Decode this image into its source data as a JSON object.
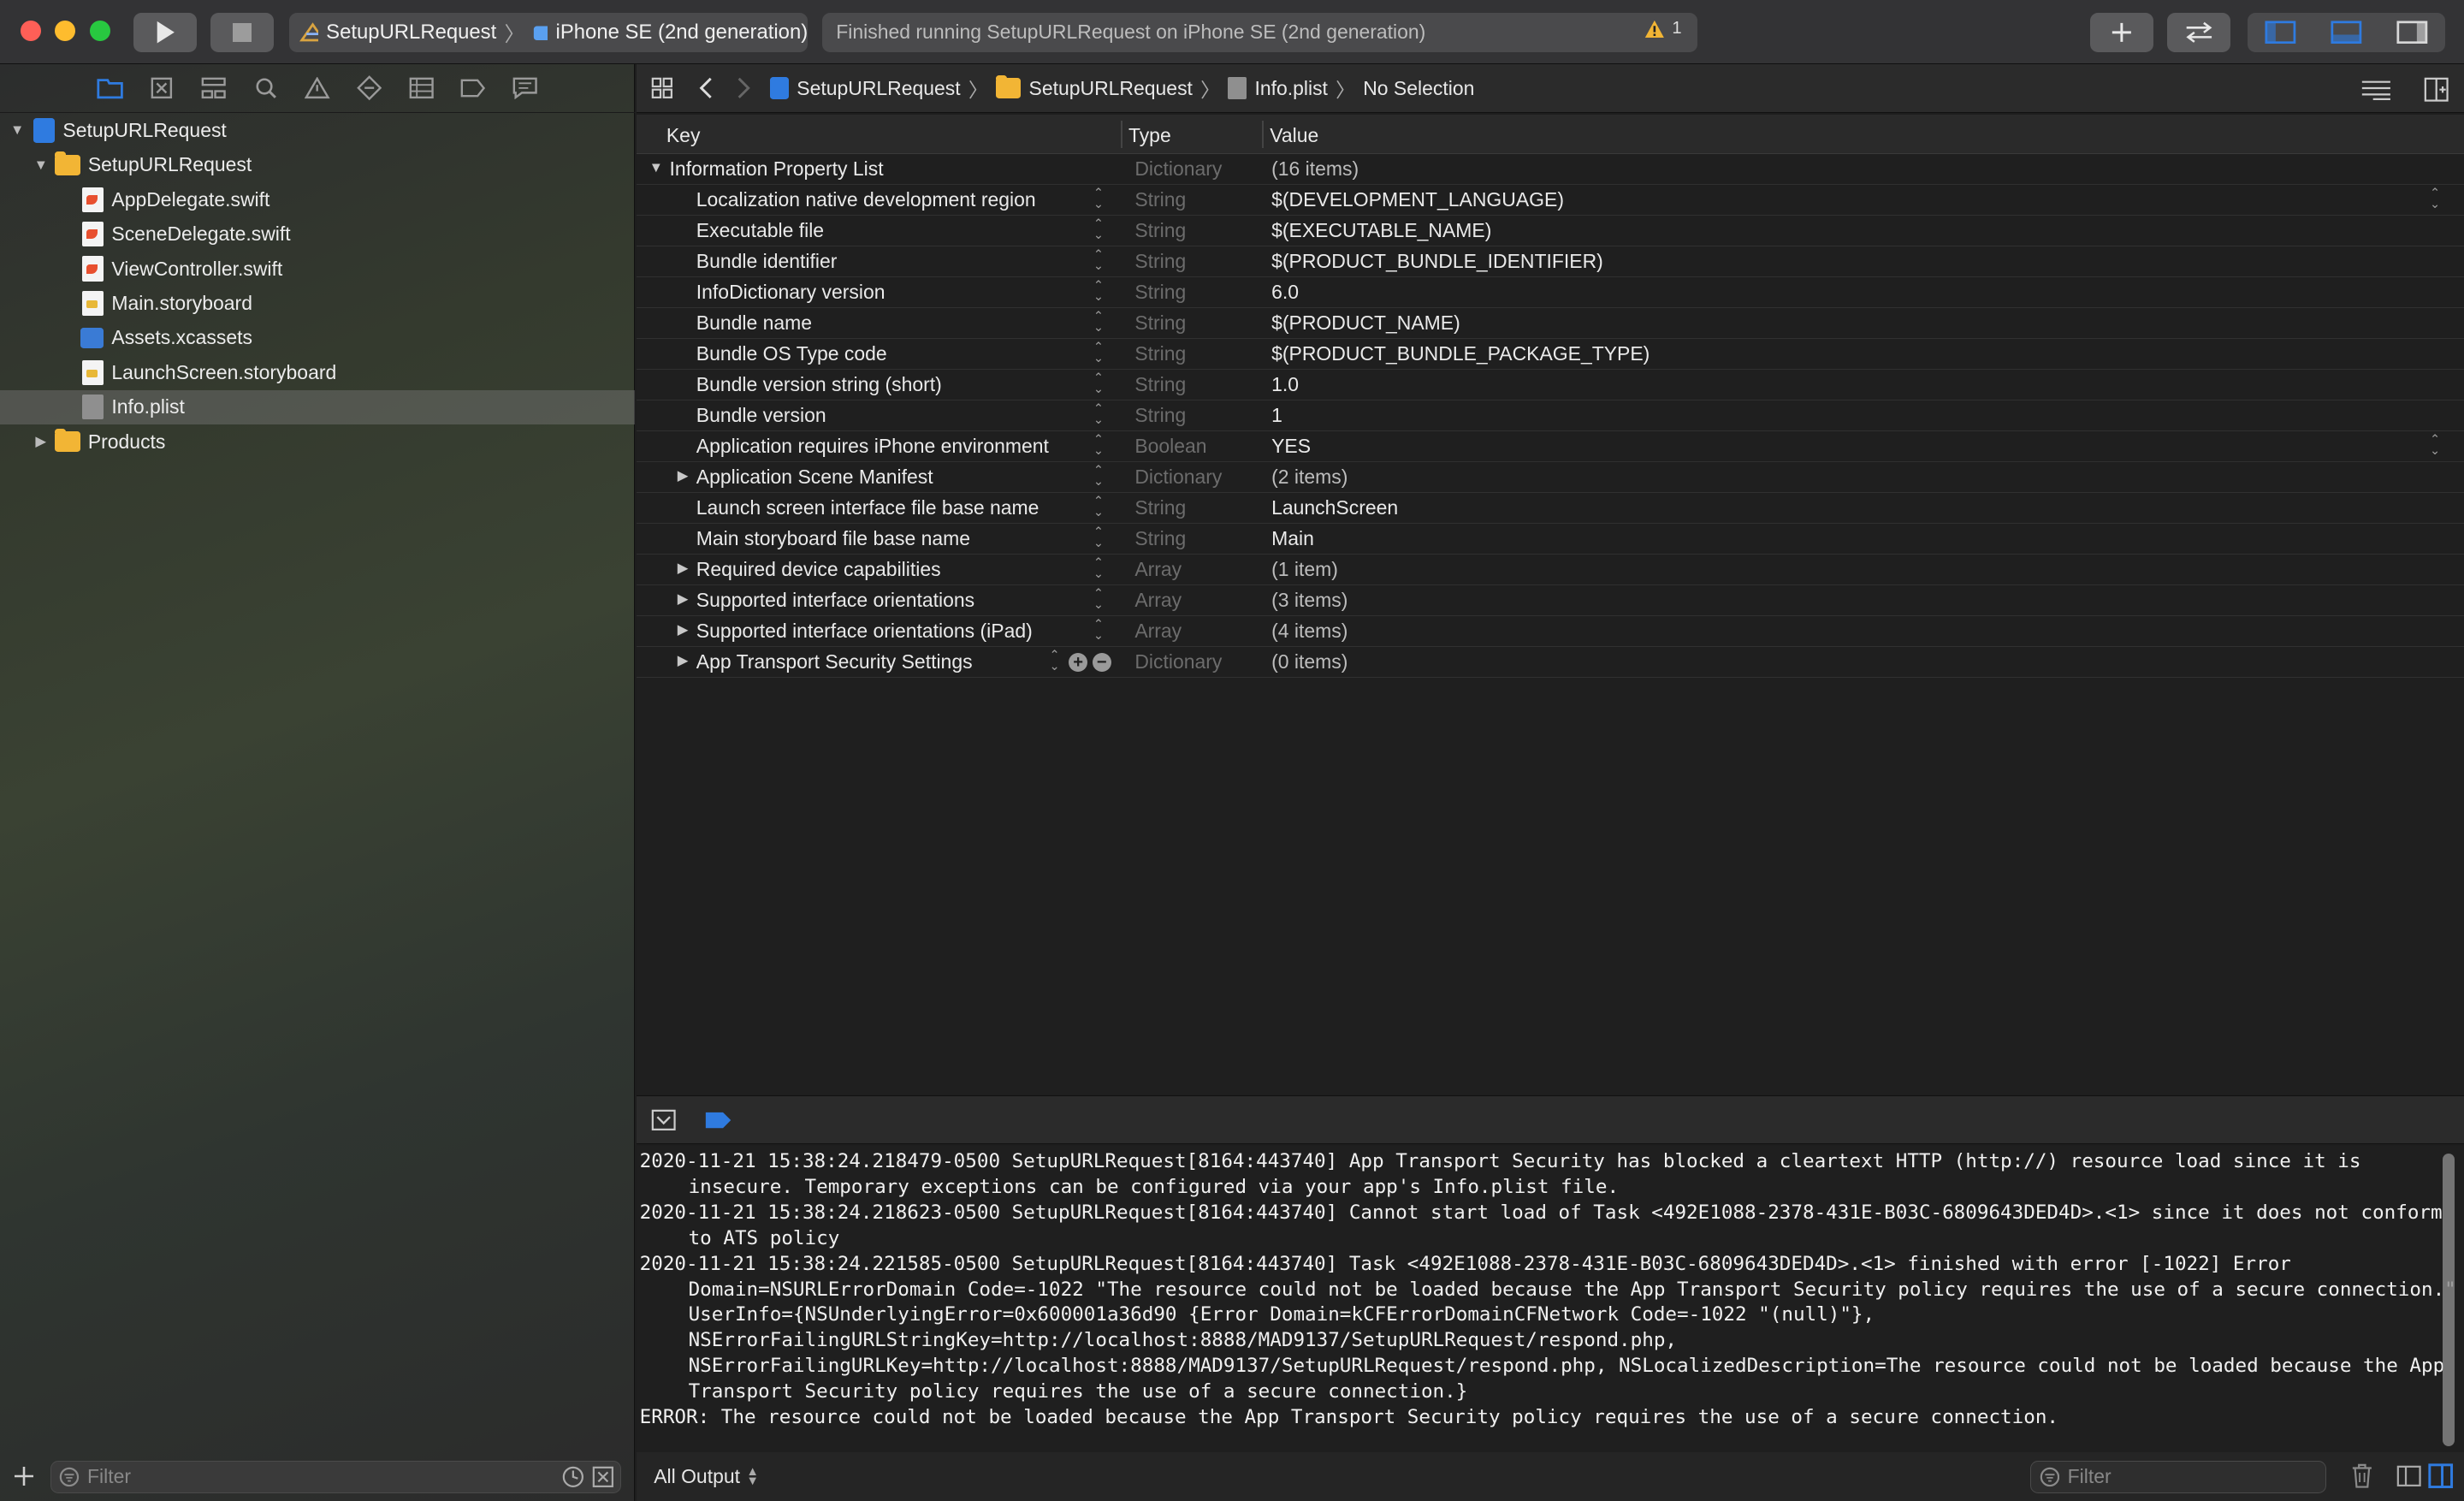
{
  "toolbar": {
    "scheme_name": "SetupURLRequest",
    "destination": "iPhone SE (2nd generation)",
    "status_text": "Finished running SetupURLRequest on iPhone SE (2nd generation)",
    "warning_count": "1"
  },
  "navigator": {
    "tree": [
      {
        "label": "SetupURLRequest",
        "kind": "project",
        "level": 0,
        "expanded": true
      },
      {
        "label": "SetupURLRequest",
        "kind": "folder",
        "level": 1,
        "expanded": true
      },
      {
        "label": "AppDelegate.swift",
        "kind": "swift",
        "level": 2
      },
      {
        "label": "SceneDelegate.swift",
        "kind": "swift",
        "level": 2
      },
      {
        "label": "ViewController.swift",
        "kind": "swift",
        "level": 2
      },
      {
        "label": "Main.storyboard",
        "kind": "storyboard",
        "level": 2
      },
      {
        "label": "Assets.xcassets",
        "kind": "assets",
        "level": 2
      },
      {
        "label": "LaunchScreen.storyboard",
        "kind": "storyboard",
        "level": 2
      },
      {
        "label": "Info.plist",
        "kind": "plist",
        "level": 2,
        "selected": true
      },
      {
        "label": "Products",
        "kind": "folder",
        "level": 1,
        "expanded": false
      }
    ],
    "filter_placeholder": "Filter"
  },
  "jumpbar": {
    "project": "SetupURLRequest",
    "group": "SetupURLRequest",
    "file": "Info.plist",
    "selection": "No Selection"
  },
  "plist": {
    "headers": {
      "key": "Key",
      "type": "Type",
      "value": "Value"
    },
    "root": {
      "key": "Information Property List",
      "type": "Dictionary",
      "value": "(16 items)"
    },
    "rows": [
      {
        "key": "Localization native development region",
        "type": "String",
        "value": "$(DEVELOPMENT_LANGUAGE)",
        "value_stepper": true
      },
      {
        "key": "Executable file",
        "type": "String",
        "value": "$(EXECUTABLE_NAME)"
      },
      {
        "key": "Bundle identifier",
        "type": "String",
        "value": "$(PRODUCT_BUNDLE_IDENTIFIER)"
      },
      {
        "key": "InfoDictionary version",
        "type": "String",
        "value": "6.0"
      },
      {
        "key": "Bundle name",
        "type": "String",
        "value": "$(PRODUCT_NAME)"
      },
      {
        "key": "Bundle OS Type code",
        "type": "String",
        "value": "$(PRODUCT_BUNDLE_PACKAGE_TYPE)"
      },
      {
        "key": "Bundle version string (short)",
        "type": "String",
        "value": "1.0"
      },
      {
        "key": "Bundle version",
        "type": "String",
        "value": "1"
      },
      {
        "key": "Application requires iPhone environment",
        "type": "Boolean",
        "value": "YES",
        "value_stepper": true
      },
      {
        "key": "Application Scene Manifest",
        "type": "Dictionary",
        "value": "(2 items)",
        "expandable": true
      },
      {
        "key": "Launch screen interface file base name",
        "type": "String",
        "value": "LaunchScreen"
      },
      {
        "key": "Main storyboard file base name",
        "type": "String",
        "value": "Main"
      },
      {
        "key": "Required device capabilities",
        "type": "Array",
        "value": "(1 item)",
        "expandable": true
      },
      {
        "key": "Supported interface orientations",
        "type": "Array",
        "value": "(3 items)",
        "expandable": true
      },
      {
        "key": "Supported interface orientations (iPad)",
        "type": "Array",
        "value": "(4 items)",
        "expandable": true
      },
      {
        "key": "App Transport Security Settings",
        "type": "Dictionary",
        "value": "(0 items)",
        "expandable": true,
        "hovered": true
      }
    ]
  },
  "console": {
    "lines": [
      "2020-11-21 15:38:24.218479-0500 SetupURLRequest[8164:443740] App Transport Security has blocked a cleartext HTTP (http://) resource load since it is insecure. Temporary exceptions can be configured via your app's Info.plist file.",
      "2020-11-21 15:38:24.218623-0500 SetupURLRequest[8164:443740] Cannot start load of Task <492E1088-2378-431E-B03C-6809643DED4D>.<1> since it does not conform to ATS policy",
      "2020-11-21 15:38:24.221585-0500 SetupURLRequest[8164:443740] Task <492E1088-2378-431E-B03C-6809643DED4D>.<1> finished with error [-1022] Error Domain=NSURLErrorDomain Code=-1022 \"The resource could not be loaded because the App Transport Security policy requires the use of a secure connection.\" UserInfo={NSUnderlyingError=0x600001a36d90 {Error Domain=kCFErrorDomainCFNetwork Code=-1022 \"(null)\"}, NSErrorFailingURLStringKey=http://localhost:8888/MAD9137/SetupURLRequest/respond.php, NSErrorFailingURLKey=http://localhost:8888/MAD9137/SetupURLRequest/respond.php, NSLocalizedDescription=The resource could not be loaded because the App Transport Security policy requires the use of a secure connection.}",
      "ERROR: The resource could not be loaded because the App Transport Security policy requires the use of a secure connection."
    ],
    "output_selector": "All Output",
    "filter_placeholder": "Filter"
  },
  "colors": {
    "accent": "#2f7be0",
    "close": "#ff5f57",
    "minimize": "#febc2e",
    "zoom": "#28c840",
    "warning": "#f2b535"
  }
}
